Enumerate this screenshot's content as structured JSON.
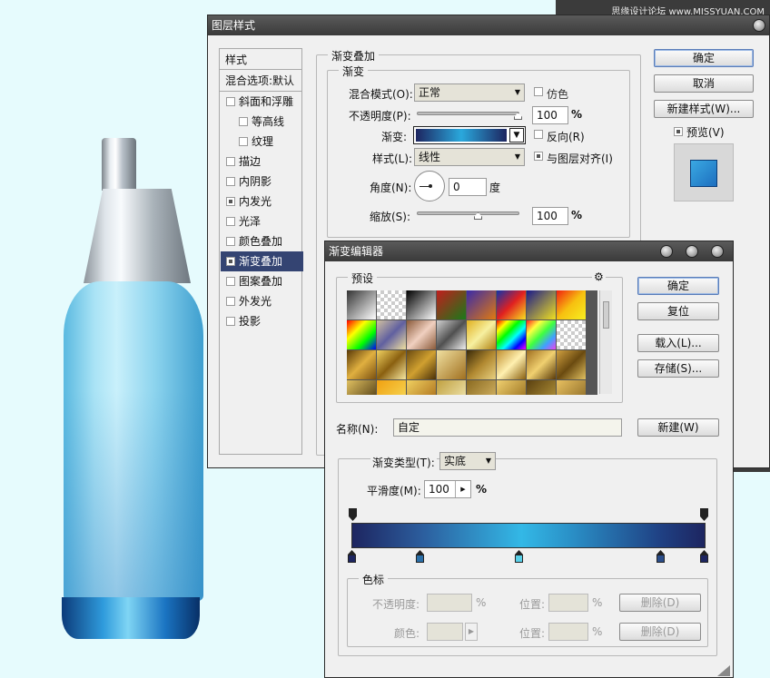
{
  "watermark": "思缘设计论坛 www.MISSYUAN.COM",
  "layer_style": {
    "title": "图层样式",
    "styles_header": "样式",
    "blend_default": "混合选项:默认",
    "items": [
      {
        "label": "斜面和浮雕",
        "checked": false,
        "active": false
      },
      {
        "label": "等高线",
        "checked": false,
        "active": false,
        "indent": true
      },
      {
        "label": "纹理",
        "checked": false,
        "active": false,
        "indent": true
      },
      {
        "label": "描边",
        "checked": false,
        "active": false
      },
      {
        "label": "内阴影",
        "checked": false,
        "active": false
      },
      {
        "label": "内发光",
        "checked": true,
        "active": false
      },
      {
        "label": "光泽",
        "checked": false,
        "active": false
      },
      {
        "label": "颜色叠加",
        "checked": false,
        "active": false
      },
      {
        "label": "渐变叠加",
        "checked": true,
        "active": true
      },
      {
        "label": "图案叠加",
        "checked": false,
        "active": false
      },
      {
        "label": "外发光",
        "checked": false,
        "active": false
      },
      {
        "label": "投影",
        "checked": false,
        "active": false
      }
    ],
    "group_outer": "渐变叠加",
    "group_inner": "渐变",
    "blend_mode_label": "混合模式(O):",
    "blend_mode_value": "正常",
    "dither_label": "仿色",
    "opacity_label": "不透明度(P):",
    "opacity_value": "100",
    "percent": "%",
    "gradient_label": "渐变:",
    "reverse_label": "反向(R)",
    "style_label": "样式(L):",
    "style_value": "线性",
    "align_label": "与图层对齐(I)",
    "angle_label": "角度(N):",
    "angle_value": "0",
    "degree": "度",
    "scale_label": "缩放(S):",
    "scale_value": "100",
    "ok": "确定",
    "cancel": "取消",
    "new_style": "新建样式(W)...",
    "preview": "预览(V)"
  },
  "gradient_editor": {
    "title": "渐变编辑器",
    "presets_label": "预设",
    "gear": "⚙",
    "ok": "确定",
    "reset": "复位",
    "load": "载入(L)...",
    "save": "存储(S)...",
    "name_label": "名称(N):",
    "name_value": "自定",
    "new_btn": "新建(W)",
    "type_label": "渐变类型(T):",
    "type_value": "实底",
    "smooth_label": "平滑度(M):",
    "smooth_value": "100",
    "percent": "%",
    "stops_group": "色标",
    "stop_opacity_label": "不透明度:",
    "stop_color_label": "颜色:",
    "position_label": "位置:",
    "delete_btn": "删除(D)"
  },
  "colors": {
    "gradient_dark": "#1d2560",
    "gradient_mid": "#2aa8dc",
    "gradient_light": "#33b8e6",
    "active_item": "#344472"
  }
}
